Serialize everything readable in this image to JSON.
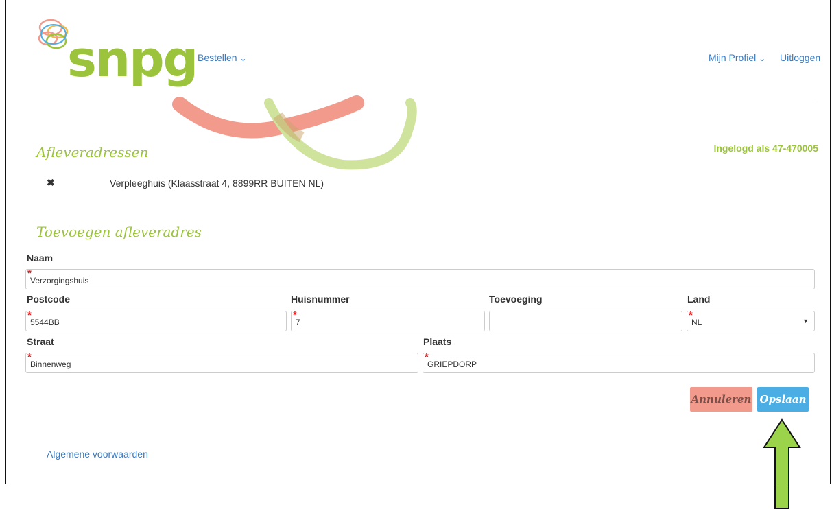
{
  "brand": {
    "name": "snpg"
  },
  "nav": {
    "order_label": "Bestellen",
    "profile_label": "Mijn Profiel",
    "logout_label": "Uitloggen",
    "chevron": "⌄"
  },
  "addresses": {
    "title": "Afleveradressen",
    "logged_in": "Ingelogd als 47-470005",
    "items": [
      {
        "remove_icon": "✖",
        "text": "Verpleeghuis (Klaasstraat 4, 8899RR BUITEN NL)"
      }
    ]
  },
  "form": {
    "title": "Toevoegen afleveradres",
    "name": {
      "label": "Naam",
      "value": "Verzorgingshuis"
    },
    "postcode": {
      "label": "Postcode",
      "value": "5544BB"
    },
    "housenumber": {
      "label": "Huisnummer",
      "value": "7"
    },
    "addition": {
      "label": "Toevoeging",
      "value": ""
    },
    "country": {
      "label": "Land",
      "value": "NL"
    },
    "street": {
      "label": "Straat",
      "value": "Binnenweg"
    },
    "city": {
      "label": "Plaats",
      "value": "GRIEPDORP"
    },
    "required_mark": "*",
    "cancel_label": "Annuleren",
    "save_label": "Opslaan"
  },
  "footer": {
    "terms_label": "Algemene voorwaarden"
  },
  "colors": {
    "brand_green": "#9bc43c",
    "link_blue": "#3a7bbf",
    "save_blue": "#4aaee4",
    "cancel_red": "#f29a8c",
    "arrow_green": "#9bd44a"
  }
}
